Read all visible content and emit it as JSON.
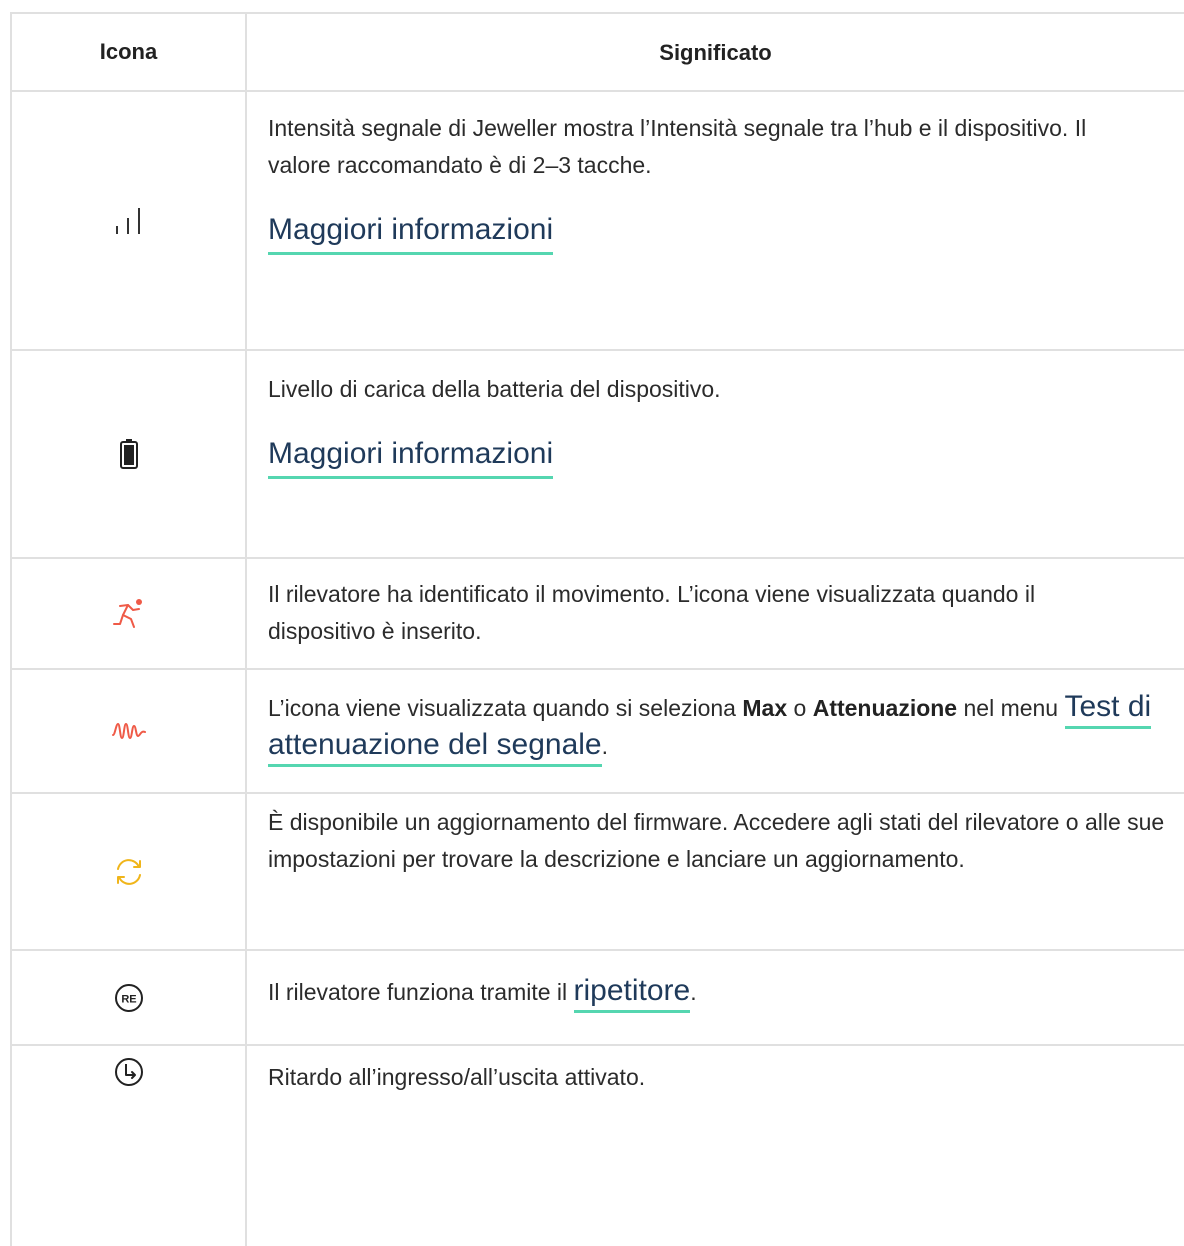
{
  "header": {
    "icon_col": "Icona",
    "meaning_col": "Significato"
  },
  "rows": {
    "signal": {
      "icon": "signal-strength-icon",
      "text": "Intensità segnale di Jeweller mostra l’Intensità segnale tra l’hub e il dispositivo. Il valore raccomandato è di 2–3 tacche.",
      "link": "Maggiori informazioni"
    },
    "battery": {
      "icon": "battery-icon",
      "text": "Livello di carica della batteria del dispositivo.",
      "link": "Maggiori informazioni"
    },
    "motion": {
      "icon": "running-person-icon",
      "text": "Il rilevatore ha identificato il movimento. L’icona viene visualizzata quando il dispositivo è inserito."
    },
    "attenuation": {
      "icon": "waveform-icon",
      "text_before": "L’icona viene visualizzata quando si seleziona ",
      "bold1": "Max",
      "mid": " o ",
      "bold2": "Attenuazione",
      "text_after": " nel menu ",
      "link": "Test di attenuazione del segnale",
      "end": "."
    },
    "firmware": {
      "icon": "update-arrows-icon",
      "text": "È disponibile un aggiornamento del firmware. Accedere agli stati del rilevatore o alle sue impostazioni per trovare la descrizione e lanciare un aggiornamento."
    },
    "repeater": {
      "icon": "re-badge-icon",
      "icon_label": "RE",
      "text_before": "Il rilevatore funziona tramite il ",
      "link": "ripetitore",
      "end": "."
    },
    "delay": {
      "icon": "clock-arrow-icon",
      "text": "Ritardo all’ingresso/all’uscita attivato."
    }
  },
  "colors": {
    "accent_underline": "#55d6b0",
    "red_icon": "#ef5a47",
    "yellow_icon": "#f0b51a",
    "border": "#e0e0e0"
  }
}
